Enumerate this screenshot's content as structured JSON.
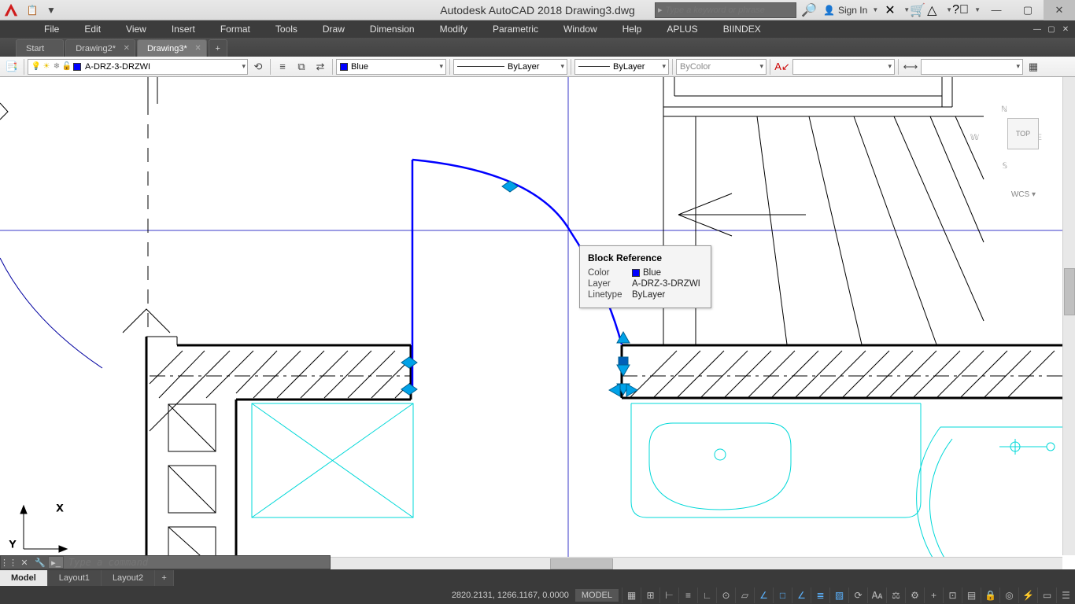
{
  "title": "Autodesk AutoCAD 2018   Drawing3.dwg",
  "search_placeholder": "Type a keyword or phrase",
  "signin_label": "Sign In",
  "menus": [
    "File",
    "Edit",
    "View",
    "Insert",
    "Format",
    "Tools",
    "Draw",
    "Dimension",
    "Modify",
    "Parametric",
    "Window",
    "Help",
    "APLUS",
    "BIINDEX"
  ],
  "doctabs": [
    {
      "label": "Start",
      "active": false,
      "closable": false
    },
    {
      "label": "Drawing2*",
      "active": false,
      "closable": true
    },
    {
      "label": "Drawing3*",
      "active": true,
      "closable": true
    }
  ],
  "layer": {
    "current": "A-DRZ-3-DRZWI",
    "color_swatch": "#0000ff"
  },
  "props": {
    "color_label": "Blue",
    "color_hex": "#0000ff",
    "linetype": "ByLayer",
    "lineweight": "ByLayer",
    "plotstyle": "ByColor",
    "textstyle": ""
  },
  "tooltip": {
    "title": "Block Reference",
    "color_label": "Color",
    "color_value": "Blue",
    "layer_label": "Layer",
    "layer_value": "A-DRZ-3-DRZWI",
    "linetype_label": "Linetype",
    "linetype_value": "ByLayer"
  },
  "navcube": {
    "face": "TOP",
    "wcs": "WCS ▾",
    "n": "N",
    "s": "S",
    "e": "E",
    "w": "W"
  },
  "cmd_placeholder": "Type a command",
  "layout_tabs": [
    "Model",
    "Layout1",
    "Layout2"
  ],
  "status": {
    "coords": "2820.2131, 1266.1167, 0.0000",
    "space": "MODEL"
  }
}
